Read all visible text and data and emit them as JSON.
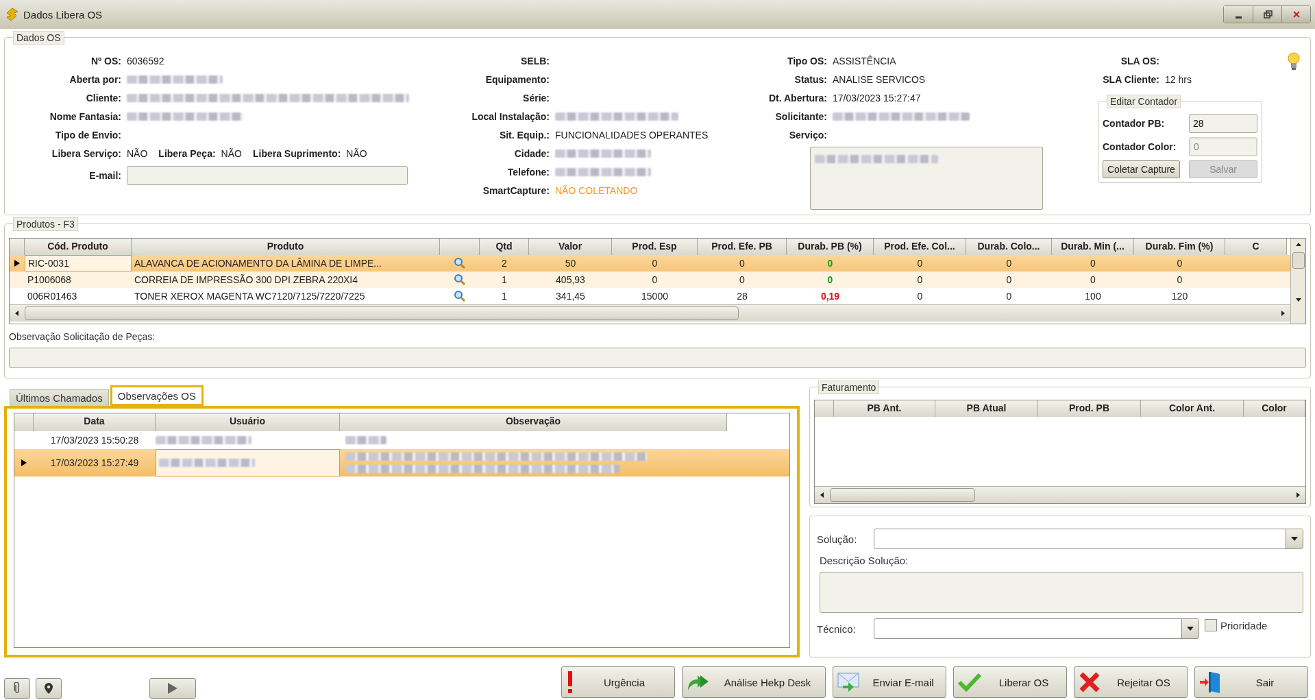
{
  "window": {
    "title": "Dados Libera OS"
  },
  "dados_os": {
    "title": "Dados OS",
    "col1": [
      {
        "label": "Nº OS:",
        "value": "6036592"
      },
      {
        "label": "Aberta por:",
        "blurred": true
      },
      {
        "label": "Cliente:",
        "blurred": true
      },
      {
        "label": "Nome Fantasia:",
        "blurred": true
      },
      {
        "label": "Tipo de Envio:"
      }
    ],
    "libera": [
      {
        "label": "Libera Serviço:",
        "value": "NÃO"
      },
      {
        "label": "Libera Peça:",
        "value": "NÃO"
      },
      {
        "label": "Libera Suprimento:",
        "value": "NÃO"
      }
    ],
    "email": {
      "label": "E-mail:"
    },
    "col2": [
      {
        "label": "SELB:"
      },
      {
        "label": "Equipamento:"
      },
      {
        "label": "Série:"
      },
      {
        "label": "Local Instalação:",
        "blurred": true
      },
      {
        "label": "Sit. Equip.:",
        "value": "FUNCIONALIDADES OPERANTES"
      },
      {
        "label": "Cidade:",
        "blurred": true
      },
      {
        "label": "Telefone:",
        "blurred": true
      },
      {
        "label": "SmartCapture:",
        "value": "NÃO COLETANDO",
        "highlighted": true
      }
    ],
    "col3": [
      {
        "label": "Tipo OS:",
        "value": "ASSISTÊNCIA"
      },
      {
        "label": "Status:",
        "value": "ANALISE SERVICOS"
      },
      {
        "label": "Dt. Abertura:",
        "value": "17/03/2023 15:27:47"
      },
      {
        "label": "Solicitante:",
        "blurred": true
      }
    ],
    "servico": {
      "label": "Serviço:",
      "blurred": true
    },
    "col4": [
      {
        "label": "SLA OS:"
      },
      {
        "label": "SLA Cliente:",
        "value": "12 hrs"
      }
    ],
    "contador": {
      "title": "Editar Contador",
      "fields": [
        {
          "label": "Contador PB:",
          "value": "28",
          "disabled": false
        },
        {
          "label": "Contador Color:",
          "value": "0",
          "disabled": true
        }
      ],
      "buttons": [
        {
          "label": "Coletar Capture",
          "disabled": false
        },
        {
          "label": "Salvar",
          "disabled": true
        }
      ]
    }
  },
  "produtos": {
    "title": "Produtos - F3",
    "columns": [
      "Cód. Produto",
      "Produto",
      "Qtd",
      "Valor",
      "Prod. Esp",
      "Prod. Efe. PB",
      "Durab. PB (%)",
      "Prod. Efe. Col...",
      "Durab. Colo...",
      "Durab. Min (...",
      "Durab. Fim (%)",
      "C"
    ],
    "rows": [
      {
        "selected": true,
        "code": "RIC-0031",
        "product": "ALAVANCA DE ACIONAMENTO DA LÂMINA DE LIMPE...",
        "qtd": "2",
        "valor": "50",
        "prod_esp": "0",
        "prod_efe_pb": "0",
        "durab_pb": {
          "text": "0",
          "alert": false
        },
        "prod_efe_col": "0",
        "durab_col": "0",
        "durab_min": "0",
        "durab_fim": "0"
      },
      {
        "selected": false,
        "code": "P1006068",
        "product": "CORREIA DE IMPRESSÃO 300 DPI ZEBRA 220XI4",
        "qtd": "1",
        "valor": "405,93",
        "prod_esp": "0",
        "prod_efe_pb": "0",
        "durab_pb": {
          "text": "0",
          "alert": false
        },
        "prod_efe_col": "0",
        "durab_col": "0",
        "durab_min": "0",
        "durab_fim": "0"
      },
      {
        "selected": false,
        "code": "006R01463",
        "product": "TONER XEROX MAGENTA WC7120/7125/7220/7225",
        "qtd": "1",
        "valor": "341,45",
        "prod_esp": "15000",
        "prod_efe_pb": "28",
        "durab_pb": {
          "text": "0,19",
          "alert": true
        },
        "prod_efe_col": "0",
        "durab_col": "0",
        "durab_min": "100",
        "durab_fim": "120"
      }
    ],
    "obs_label": "Observação Solicitação de Peças:"
  },
  "tabs": [
    {
      "label": "Últimos Chamados",
      "selected": false
    },
    {
      "label": "Observações OS",
      "selected": true
    }
  ],
  "observacoes": {
    "columns": [
      "Data",
      "Usuário",
      "Observação"
    ],
    "rows": [
      {
        "selected": false,
        "date": "17/03/2023 15:50:28",
        "user_blurred": true,
        "obs_blurred": true
      },
      {
        "selected": true,
        "date": "17/03/2023 15:27:49",
        "user_blurred": true,
        "obs_blurred": true
      }
    ]
  },
  "faturamento": {
    "title": "Faturamento",
    "columns": [
      "PB Ant.",
      "PB Atual",
      "Prod. PB",
      "Color Ant.",
      "Color"
    ]
  },
  "solucao": {
    "solucao_label": "Solução:",
    "descricao_label": "Descrição Solução:",
    "tecnico_label": "Técnico:",
    "prioridade": {
      "label": "Prioridade",
      "checked": false
    }
  },
  "tool_buttons": [
    {
      "kind": "attach"
    },
    {
      "kind": "location"
    },
    {
      "kind": "play"
    }
  ],
  "actions": [
    {
      "label": "Urgência",
      "kind": "urgent"
    },
    {
      "label": "Análise Hekp Desk",
      "kind": "forward"
    },
    {
      "label": "Enviar E-mail",
      "kind": "mail"
    },
    {
      "label": "Liberar OS",
      "kind": "approve"
    },
    {
      "label": "Rejeitar OS",
      "kind": "reject"
    },
    {
      "label": "Sair",
      "kind": "exit"
    }
  ]
}
